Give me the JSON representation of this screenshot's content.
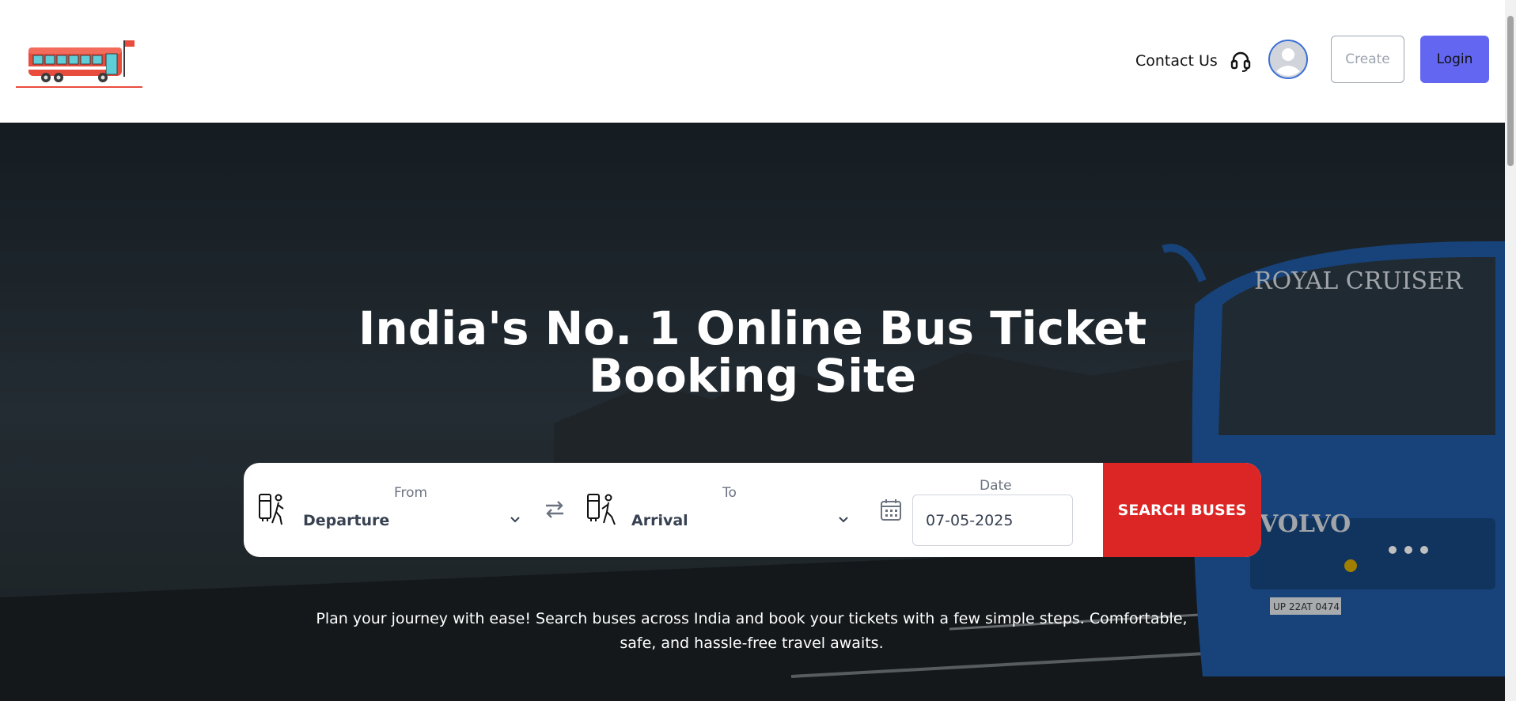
{
  "header": {
    "contact_label": "Contact Us",
    "create_label": "Create",
    "login_label": "Login"
  },
  "icons": {
    "logo": "bus-logo-icon",
    "contact": "headset-icon",
    "avatar": "user-avatar-icon",
    "departure": "person-departing-icon",
    "arrival": "person-arriving-icon",
    "swap": "swap-arrows-icon",
    "calendar": "calendar-icon",
    "dropdown": "chevron-down-icon"
  },
  "hero": {
    "title_line1": "India's No. 1 Online Bus Ticket",
    "title_line2": "Booking Site",
    "bus_brand_text": "ROYAL CRUISER",
    "bus_grille_text": "VOLVO",
    "bus_plate_text": "UP 22AT 0474",
    "description": "Plan your journey with ease! Search buses across India and book your tickets with a few simple steps. Comfortable, safe, and hassle-free travel awaits."
  },
  "search": {
    "from_caption": "From",
    "from_value": "Departure",
    "to_caption": "To",
    "to_value": "Arrival",
    "date_caption": "Date",
    "date_value": "07-05-2025",
    "button_label": "SEARCH BUSES"
  },
  "colors": {
    "accent": "#6366f1",
    "search_button": "#dc2626",
    "logo_red": "#e84c3d"
  }
}
